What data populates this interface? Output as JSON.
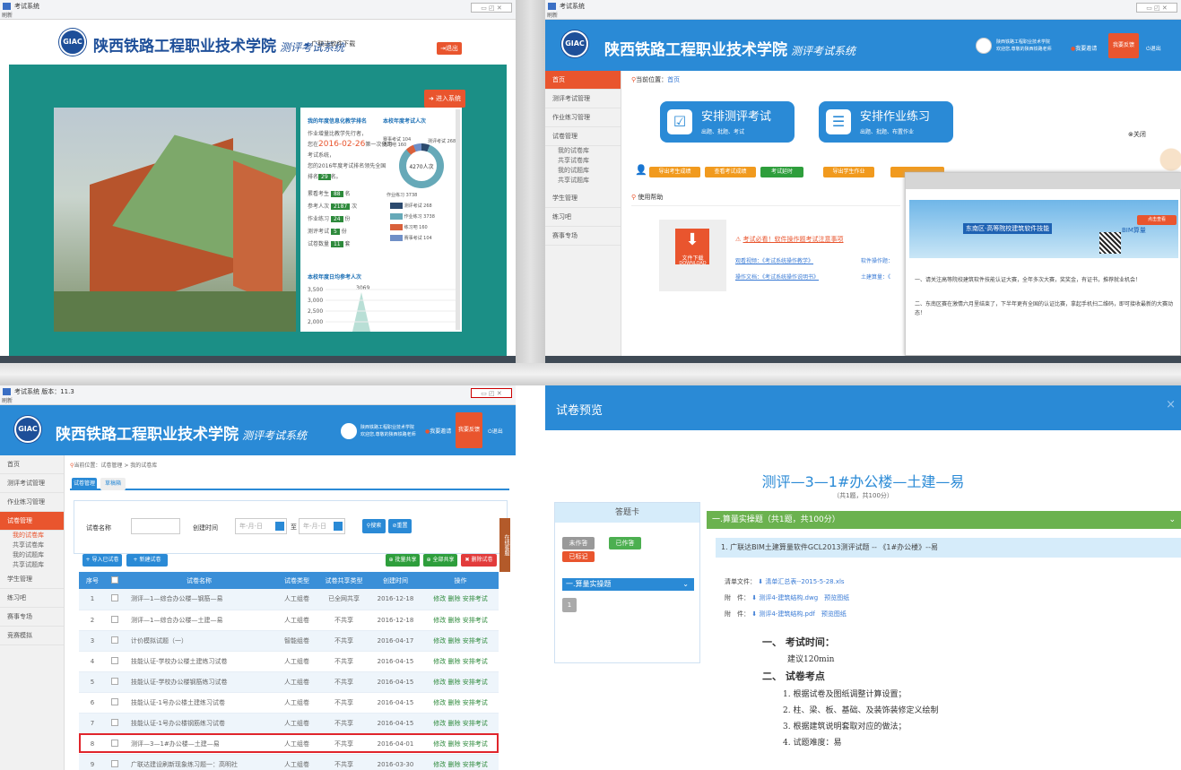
{
  "p1": {
    "title": "考试系统",
    "subtitle": "刷新",
    "logo": "GIAC",
    "school": "陕西铁路工程职业技术学院",
    "system": "测评考试系统",
    "download": "广联达软件下载",
    "exit": "退出",
    "enter": "进入系统",
    "stats": {
      "head": "我的年度信息化教学排名",
      "l1": "作业增量比教学先行者，",
      "date": "2016-02-26",
      "l2a": "您在",
      "l2b": "第一次使用",
      "l3": "考试系统，",
      "l4": "您的2016年度考试排名领先全国",
      "l5a": "排名",
      "rank": "29",
      "l5b": "名。",
      "rows": [
        {
          "k": "累看考生",
          "v": "88",
          "u": "名"
        },
        {
          "k": "参考人次",
          "v": "2187",
          "u": "次"
        },
        {
          "k": "作业练习",
          "v": "24",
          "u": "份"
        },
        {
          "k": "测评考试",
          "v": "5",
          "u": "份"
        },
        {
          "k": "试卷数量",
          "v": "11",
          "u": "套"
        }
      ]
    },
    "donut": {
      "head": "本校年度考试人次",
      "center": "4270人次",
      "lt1": "赛事考试 104",
      "lt2": "练习吧 160",
      "rt": "测评考试 268",
      "lb": "作业练习 3738",
      "legend": [
        {
          "label": "测评考试 268",
          "color": "#2c4a6e"
        },
        {
          "label": "作业练习 3738",
          "color": "#66a9b8"
        },
        {
          "label": "练习吧 160",
          "color": "#d9603b"
        },
        {
          "label": "赛事考试 104",
          "color": "#6f8fc7"
        }
      ]
    },
    "line": {
      "head": "本校年度日均参考人次",
      "yt": [
        "3,500",
        "3,000",
        "2,500",
        "2,000"
      ],
      "peak": "3069"
    }
  },
  "p2": {
    "title": "考试系统",
    "subtitle": "刷新",
    "logo": "GIAC",
    "school": "陕西铁路工程职业技术学院",
    "system": "测评考试系统",
    "user1": "陕西铁路工程职业技术学院",
    "user2": "欢迎您,尊敬的陕西铁路老师",
    "invite": "我要邀请",
    "feedback": "我要反馈",
    "exit": "退出",
    "nav": [
      "首页",
      "测评考试管理",
      "作业练习管理",
      "试卷管理",
      "我的试卷库",
      "共享试卷库",
      "我的试题库",
      "共享试题库",
      "学生管理",
      "练习吧",
      "赛事专场"
    ],
    "loc_label": "当前位置：",
    "loc": "首页",
    "c1t": "安排测评考试",
    "c1s": "出题、批题、考试",
    "c2t": "安排作业练习",
    "c2s": "出题、批题、布置作业",
    "b1": "导出考生成绩",
    "b2": "查看考试成绩",
    "b3": "考试延时",
    "b4": "导出学生作业",
    "help": "使用帮助",
    "dl1": "文件下载",
    "dl2": "DOWNLOAD",
    "notice": "考试必看！软件操作题考试注意事项",
    "v1": "观看视频：《考试系统操作教学》",
    "v2": "软件操作题：",
    "m1": "操作文档：《考试系统操作说明书》",
    "m2": "土建算量：《",
    "close": "关闭",
    "banner": "东南区·高等院校建筑软件技能",
    "banner2": "BIM算量",
    "bannerbtn": "点击查看",
    "pop1": "一、请关注高等院校建筑软件技能认证大赛，全年多次大赛，奖奖金，有证书，推荐就业机会！",
    "pop2": "二、东南区赛在激情六月里结束了，下半年更有全国的认证比赛，拿起手机扫二维码，即可接收最新的大赛动态！"
  },
  "p3": {
    "title": "考试系统 版本：11.3",
    "subtitle": "刷新",
    "logo": "GIAC",
    "school": "陕西铁路工程职业技术学院",
    "system": "测评考试系统",
    "user1": "陕西铁路工程职业技术学院",
    "user2": "欢迎您,尊敬的陕西铁路老师",
    "invite": "我要邀请",
    "feedback": "我要反馈",
    "exit": "退出",
    "nav": [
      "首页",
      "测评考试管理",
      "作业练习管理",
      "试卷管理"
    ],
    "subnav": [
      "我的试卷库",
      "共享试卷库",
      "我的试题库",
      "共享试题库"
    ],
    "nav2": [
      "学生管理",
      "练习吧",
      "赛事专场",
      "竞赛模拟"
    ],
    "loc_label": "当前位置：",
    "loc": "试卷管理 > 我的试卷库",
    "tab1": "试卷管理",
    "tab2": "草稿箱",
    "f_name": "试卷名称",
    "f_time": "创建时间",
    "f_date1": "年-月-日",
    "f_to": "至",
    "f_date2": "年-月-日",
    "search": "搜索",
    "reset": "重置",
    "add1": "导入已试卷",
    "add2": "新建试卷",
    "share1": "批量共享",
    "share2": "全部共享",
    "del": "删除试卷",
    "side_tab": "在线客服",
    "cols": [
      "序号",
      "",
      "试卷名称",
      "试卷类型",
      "试卷共享类型",
      "创建时间",
      "操作"
    ],
    "rows": [
      [
        "1",
        "测评—1—综合办公楼—钢筋—易",
        "人工组卷",
        "已全网共享",
        "2016-12-18"
      ],
      [
        "2",
        "测评—1—综合办公楼—土建—易",
        "人工组卷",
        "不共享",
        "2016-12-18"
      ],
      [
        "3",
        "计价模拟试题（一）",
        "智能组卷",
        "不共享",
        "2016-04-17"
      ],
      [
        "4",
        "技能认证-学校办公楼土建练习试卷",
        "人工组卷",
        "不共享",
        "2016-04-15"
      ],
      [
        "5",
        "技能认证-学校办公楼钢筋练习试卷",
        "人工组卷",
        "不共享",
        "2016-04-15"
      ],
      [
        "6",
        "技能认证-1号办公楼土建练习试卷",
        "人工组卷",
        "不共享",
        "2016-04-15"
      ],
      [
        "7",
        "技能认证-1号办公楼钢筋练习试卷",
        "人工组卷",
        "不共享",
        "2016-04-15"
      ],
      [
        "8",
        "测评—3—1#办公楼—土建—易",
        "人工组卷",
        "不共享",
        "2016-04-01"
      ],
      [
        "9",
        "广联达建设刷新现象练习题一：高明社",
        "人工组卷",
        "不共享",
        "2016-03-30"
      ]
    ],
    "ops": "修改 删除 安排考试"
  },
  "p4": {
    "title": "试卷预览",
    "close": "×",
    "exam_title": "测评—3—1#办公楼—土建—易",
    "exam_sub": "（共1题，共100分）",
    "card": "答题卡",
    "unans": "未作答",
    "ans": "已作答",
    "marked": "已标记",
    "sect": "一.算量实操题",
    "q_num": "1",
    "sect_head": "一.算量实操题（共1题，共100分）",
    "q_title": "1. 广联达BIM土建算量软件GCL2013测评试题 -- 《1#办公楼》--易",
    "list_label": "清单文件：",
    "list_file": "清单汇总表--2015-5-28.xls",
    "att_label": "附　件：",
    "att1": "测评4-建筑结构.dwg",
    "att2": "测评4-建筑结构.pdf",
    "preview": "预览图纸",
    "h1": "一、 考试时间：",
    "t1": "建议120min",
    "h2": "二、 试卷考点",
    "pts": [
      "1. 根据试卷及图纸调整计算设置；",
      "2. 柱、梁、板、基础、及装饰装修定义绘制",
      "3. 根据建筑说明套取对应的做法；",
      "4. 试题难度：易"
    ]
  }
}
